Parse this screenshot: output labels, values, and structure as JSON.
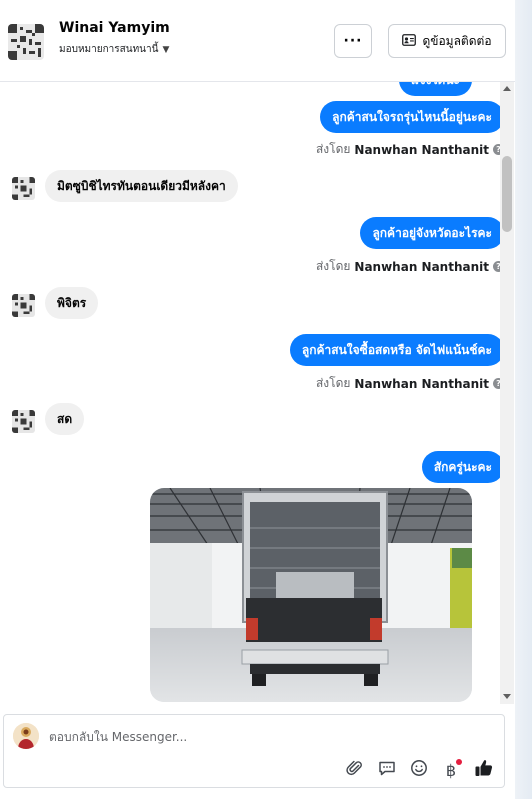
{
  "header": {
    "contact_name": "Winai Yamyim",
    "assign_label": "มอบหมายการสนทนานี้",
    "more_label": "···",
    "contact_info_label": "ดูข้อมูลติดต่อ"
  },
  "messages": {
    "out_partial": "แจ้งได้นะ",
    "out_1": "ลูกค้าสนใจรถรุ่นไหนนี้อยู่นะคะ",
    "in_1": "มิตซูบิชิไทรทันตอนเดียวมีหลังคา",
    "out_2": "ลูกค้าอยู่จังหวัดอะไรคะ",
    "in_2": "พิจิตร",
    "out_3": "ลูกค้าสนใจซื้อสดหรือ จัดไฟแน้นช์คะ",
    "in_3": "สด",
    "out_4": "สักครู่นะคะ"
  },
  "sender": {
    "prefix": "ส่งโดย",
    "name": "Nanwhan Nanthanit",
    "help": "?"
  },
  "composer": {
    "placeholder": "ตอบกลับใน Messenger...",
    "baht_symbol": "฿"
  },
  "icons": {
    "attach": "paperclip-icon",
    "saved_replies": "chat-bubble-icon",
    "emoji": "smiley-icon",
    "payment": "baht-icon",
    "like": "thumbs-up-icon"
  },
  "colors": {
    "outgoing_bubble": "#0a7cff",
    "incoming_bubble": "#f0f0f0",
    "notification_dot": "#e41e3f"
  }
}
